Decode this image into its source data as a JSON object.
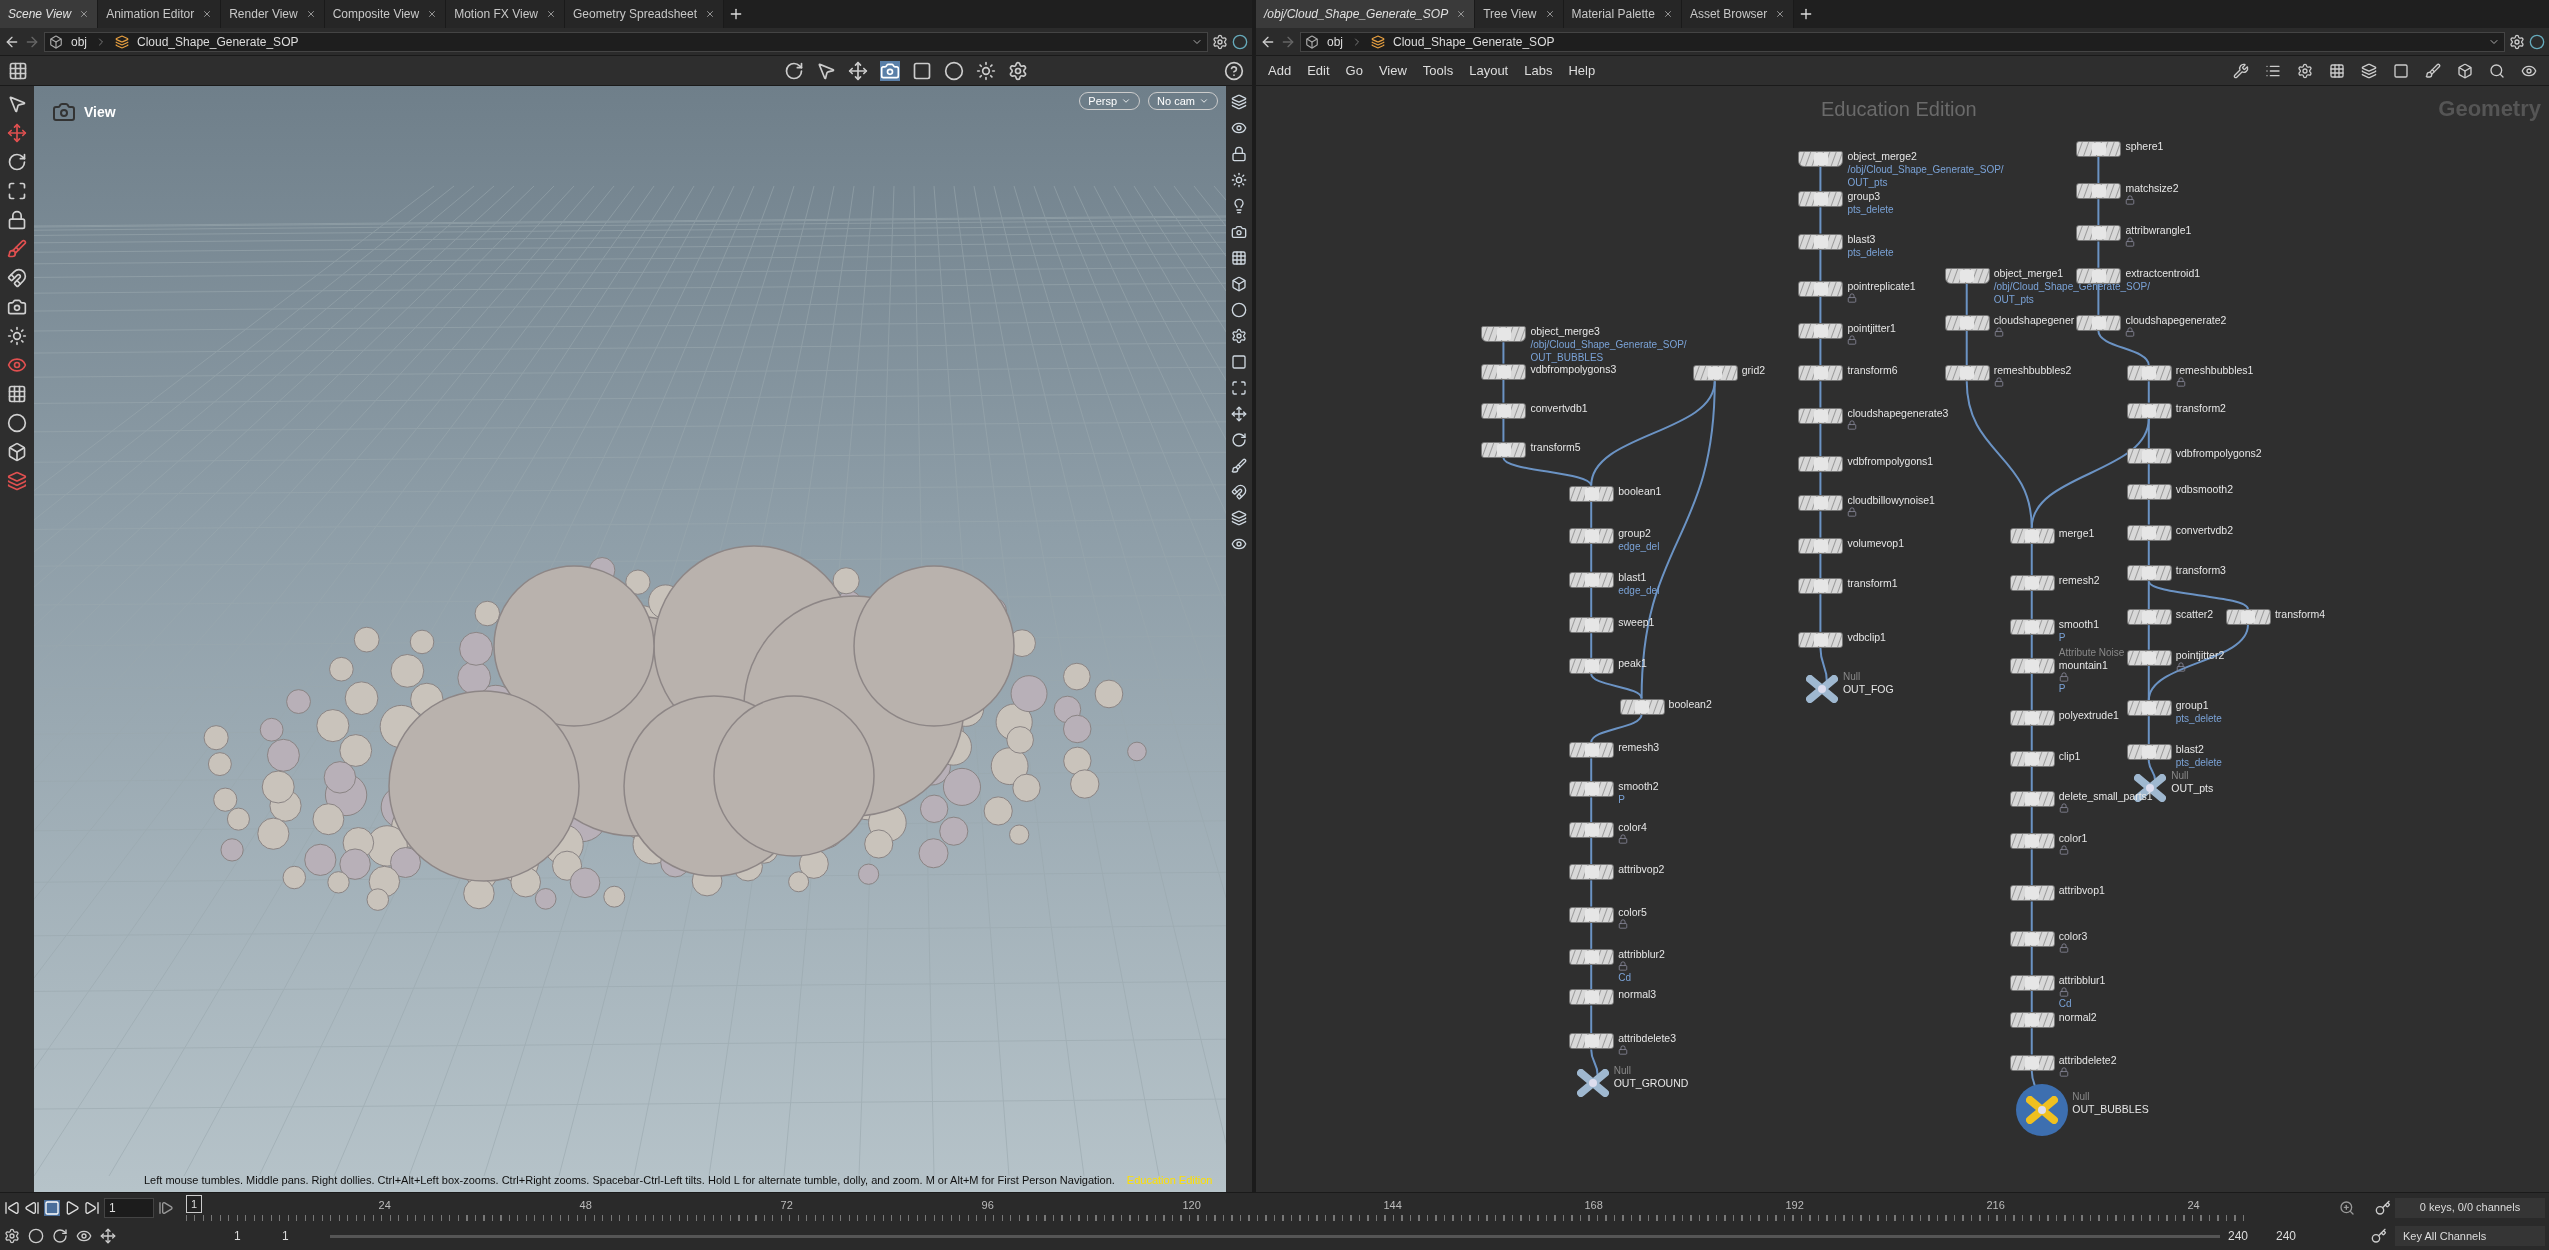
{
  "left_tabs": [
    {
      "label": "Scene View",
      "selected": true
    },
    {
      "label": "Animation Editor",
      "selected": false
    },
    {
      "label": "Render View",
      "selected": false
    },
    {
      "label": "Composite View",
      "selected": false
    },
    {
      "label": "Motion FX View",
      "selected": false
    },
    {
      "label": "Geometry Spreadsheet",
      "selected": false
    }
  ],
  "left_path": {
    "root": "obj",
    "node": "Cloud_Shape_Generate_SOP"
  },
  "viewport": {
    "title": "View",
    "menus": [
      "Persp",
      "No cam"
    ],
    "hint": "Left mouse tumbles. Middle pans. Right dollies. Ctrl+Alt+Left box-zooms. Ctrl+Right zooms. Spacebar-Ctrl-Left tilts. Hold L for alternate tumble, dolly, and zoom. M or Alt+M for First Person Navigation.",
    "edition": "Education Edition"
  },
  "right_tabs": [
    {
      "label": "/obj/Cloud_Shape_Generate_SOP",
      "selected": true
    },
    {
      "label": "Tree View",
      "selected": false
    },
    {
      "label": "Material Palette",
      "selected": false
    },
    {
      "label": "Asset Browser",
      "selected": false
    }
  ],
  "right_path": {
    "root": "obj",
    "node": "Cloud_Shape_Generate_SOP"
  },
  "menu": [
    "Add",
    "Edit",
    "Go",
    "View",
    "Tools",
    "Layout",
    "Labs",
    "Help"
  ],
  "network": {
    "watermark": "Education Edition",
    "context": "Geometry",
    "nodes": [
      {
        "name": "object_merge3",
        "kind": "merge",
        "locked": false,
        "notes": [
          "/obj/Cloud_Shape_Generate_SOP/",
          "OUT_BUBBLES"
        ]
      },
      {
        "name": "vdbfrompolygons3",
        "kind": "sop",
        "locked": false
      },
      {
        "name": "convertvdb1",
        "kind": "sop",
        "locked": false
      },
      {
        "name": "transform5",
        "kind": "sop",
        "locked": false
      },
      {
        "name": "grid2",
        "kind": "sop",
        "locked": false
      },
      {
        "name": "boolean1",
        "kind": "sop",
        "locked": false
      },
      {
        "name": "group2",
        "kind": "sop",
        "locked": false,
        "notes": [
          "edge_del"
        ]
      },
      {
        "name": "blast1",
        "kind": "sop",
        "locked": false,
        "notes": [
          "edge_del"
        ]
      },
      {
        "name": "sweep1",
        "kind": "sop",
        "locked": false
      },
      {
        "name": "peak1",
        "kind": "sop",
        "locked": false
      },
      {
        "name": "boolean2",
        "kind": "sop",
        "locked": false
      },
      {
        "name": "remesh3",
        "kind": "sop",
        "locked": false
      },
      {
        "name": "smooth2",
        "kind": "sop",
        "locked": false,
        "notes": [
          "P"
        ]
      },
      {
        "name": "color4",
        "kind": "sop",
        "locked": true
      },
      {
        "name": "attribvop2",
        "kind": "sop",
        "locked": false
      },
      {
        "name": "color5",
        "kind": "sop",
        "locked": true
      },
      {
        "name": "attribblur2",
        "kind": "sop",
        "locked": true,
        "notes": [
          "Cd"
        ]
      },
      {
        "name": "normal3",
        "kind": "sop",
        "locked": false
      },
      {
        "name": "attribdelete3",
        "kind": "sop",
        "locked": true
      },
      {
        "name": "OUT_GROUND",
        "kind": "null",
        "type_label": "Null",
        "locked": false
      },
      {
        "name": "object_merge2",
        "kind": "merge",
        "locked": false,
        "notes": [
          "/obj/Cloud_Shape_Generate_SOP/",
          "OUT_pts"
        ]
      },
      {
        "name": "group3",
        "kind": "sop",
        "locked": false,
        "notes": [
          "pts_delete"
        ]
      },
      {
        "name": "blast3",
        "kind": "sop",
        "locked": false,
        "notes": [
          "pts_delete"
        ]
      },
      {
        "name": "pointreplicate1",
        "kind": "sop",
        "locked": true
      },
      {
        "name": "pointjitter1",
        "kind": "sop",
        "locked": true
      },
      {
        "name": "transform6",
        "kind": "sop",
        "locked": false
      },
      {
        "name": "cloudshapegenerate3",
        "kind": "sop",
        "locked": true
      },
      {
        "name": "vdbfrompolygons1",
        "kind": "sop",
        "locked": false
      },
      {
        "name": "cloudbillowynoise1",
        "kind": "sop",
        "locked": true
      },
      {
        "name": "volumevop1",
        "kind": "sop",
        "locked": false
      },
      {
        "name": "transform1",
        "kind": "sop",
        "locked": false
      },
      {
        "name": "vdbclip1",
        "kind": "sop",
        "locked": false
      },
      {
        "name": "OUT_FOG",
        "kind": "null",
        "type_label": "Null",
        "locked": false
      },
      {
        "name": "object_merge1",
        "kind": "merge",
        "locked": false,
        "notes": [
          "/obj/Cloud_Shape_Generate_SOP/",
          "OUT_pts"
        ]
      },
      {
        "name": "cloudshapegener",
        "kind": "sop",
        "locked": true
      },
      {
        "name": "remeshbubbles2",
        "kind": "sop",
        "locked": true
      },
      {
        "name": "sphere1",
        "kind": "sop",
        "locked": false
      },
      {
        "name": "matchsize2",
        "kind": "sop",
        "locked": true
      },
      {
        "name": "attribwrangle1",
        "kind": "sop",
        "locked": true
      },
      {
        "name": "extractcentroid1",
        "kind": "sop",
        "locked": false
      },
      {
        "name": "cloudshapegenerate2",
        "kind": "sop",
        "locked": true
      },
      {
        "name": "remeshbubbles1",
        "kind": "sop",
        "locked": true
      },
      {
        "name": "transform2",
        "kind": "sop",
        "locked": false
      },
      {
        "name": "vdbfrompolygons2",
        "kind": "sop",
        "locked": false
      },
      {
        "name": "vdbsmooth2",
        "kind": "sop",
        "locked": false
      },
      {
        "name": "convertvdb2",
        "kind": "sop",
        "locked": false
      },
      {
        "name": "transform3",
        "kind": "sop",
        "locked": false
      },
      {
        "name": "scatter2",
        "kind": "sop",
        "locked": false
      },
      {
        "name": "transform4",
        "kind": "sop",
        "locked": false
      },
      {
        "name": "pointjitter2",
        "kind": "sop",
        "locked": true
      },
      {
        "name": "group1",
        "kind": "sop",
        "locked": false,
        "notes": [
          "pts_delete"
        ]
      },
      {
        "name": "blast2",
        "kind": "sop",
        "locked": false,
        "notes": [
          "pts_delete"
        ]
      },
      {
        "name": "OUT_pts",
        "kind": "null",
        "type_label": "Null",
        "locked": false
      },
      {
        "name": "merge1",
        "kind": "sop",
        "locked": false
      },
      {
        "name": "remesh2",
        "kind": "sop",
        "locked": false
      },
      {
        "name": "smooth1",
        "kind": "sop",
        "locked": false,
        "notes": [
          "P"
        ]
      },
      {
        "name": "mountain1",
        "kind": "sop",
        "type_label": "Attribute Noise",
        "locked": true,
        "notes": [
          "P"
        ]
      },
      {
        "name": "polyextrude1",
        "kind": "sop",
        "locked": false
      },
      {
        "name": "clip1",
        "kind": "sop",
        "locked": false
      },
      {
        "name": "delete_small_parts1",
        "kind": "sop",
        "locked": true
      },
      {
        "name": "color1",
        "kind": "sop",
        "locked": true
      },
      {
        "name": "attribvop1",
        "kind": "sop",
        "locked": false
      },
      {
        "name": "color3",
        "kind": "sop",
        "locked": true
      },
      {
        "name": "attribblur1",
        "kind": "sop",
        "locked": true,
        "notes": [
          "Cd"
        ]
      },
      {
        "name": "normal2",
        "kind": "sop",
        "locked": false
      },
      {
        "name": "attribdelete2",
        "kind": "sop",
        "locked": true
      },
      {
        "name": "OUT_BUBBLES",
        "kind": "display",
        "type_label": "Null",
        "locked": false
      }
    ]
  },
  "timeline": {
    "frame": "1",
    "current": "1",
    "ticks": [
      "24",
      "48",
      "72",
      "96",
      "120",
      "144",
      "168",
      "192",
      "216",
      "24"
    ],
    "start": "1",
    "range_start": "1",
    "range_end": "240",
    "end": "240",
    "keys": "0 keys, 0/0 channels",
    "key_button": "Key All Channels"
  }
}
